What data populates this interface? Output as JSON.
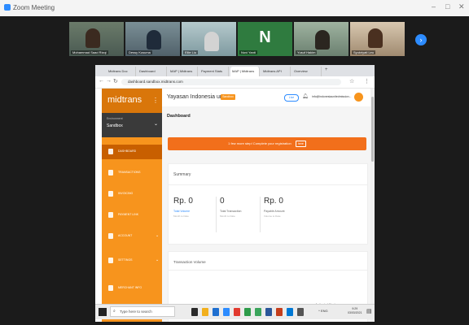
{
  "zoom": {
    "window_title": "Zoom Meeting",
    "participants": [
      {
        "name": "Mohammad Saad Rizqi",
        "initial": ""
      },
      {
        "name": "Dessy Kusuma",
        "initial": ""
      },
      {
        "name": "Ellie Liu",
        "initial": ""
      },
      {
        "name": "Novi Yanti",
        "initial": "N"
      },
      {
        "name": "Yusuf Hakim",
        "initial": ""
      },
      {
        "name": "Syukriyati Leu",
        "initial": ""
      }
    ]
  },
  "browser": {
    "tabs": [
      "Midtrans Doc",
      "Dashboard",
      "MAP | Midtrans",
      "Payment Stats",
      "MAP | Midtrans",
      "Midtrans API",
      "Overview"
    ],
    "url": "dashboard.sandbox.midtrans.com"
  },
  "app": {
    "logo": "midtrans",
    "environment_label": "Environment",
    "environment_value": "Sandbox",
    "nav": [
      {
        "label": "DASHBOARD",
        "has_chevron": false,
        "active": true
      },
      {
        "label": "TRANSACTIONS",
        "has_chevron": false,
        "active": false
      },
      {
        "label": "INVOICING",
        "has_chevron": false,
        "active": false
      },
      {
        "label": "PAYMENT LINK",
        "has_chevron": false,
        "active": false
      },
      {
        "label": "ACCOUNT",
        "has_chevron": true,
        "active": false
      },
      {
        "label": "SETTINGS",
        "has_chevron": true,
        "active": false
      },
      {
        "label": "MERCHANT INFO",
        "has_chevron": false,
        "active": false
      }
    ],
    "business_name": "Yayasan Indonesia unt...",
    "business_badge": "Sandbox",
    "live_toggle": "Live",
    "user_email": "info@indonesiaunitedmission...",
    "page_title": "Dashboard",
    "registration_banner": "1 few more step! Complete your registration",
    "registration_button": "here",
    "summary_title": "Summary",
    "stats": [
      {
        "value": "Rp. 0",
        "label": "Total Volume",
        "sub": "Month to Date"
      },
      {
        "value": "0",
        "label": "Total Transaction",
        "sub": "Month to Date"
      },
      {
        "value": "Rp. 0",
        "label": "Payable Amount",
        "sub": "Volume to Date"
      }
    ],
    "transaction_volume_title": "Transaction Volume",
    "activate_windows": "Activate Windows"
  },
  "taskbar": {
    "search_placeholder": "Type here to search",
    "clock_time": "9:29",
    "clock_date": "03/03/2021",
    "tray_text": "^ ENG"
  },
  "colors": {
    "accent": "#f7941d",
    "banner": "#f26f1b",
    "zoom_blue": "#2d8cff"
  }
}
